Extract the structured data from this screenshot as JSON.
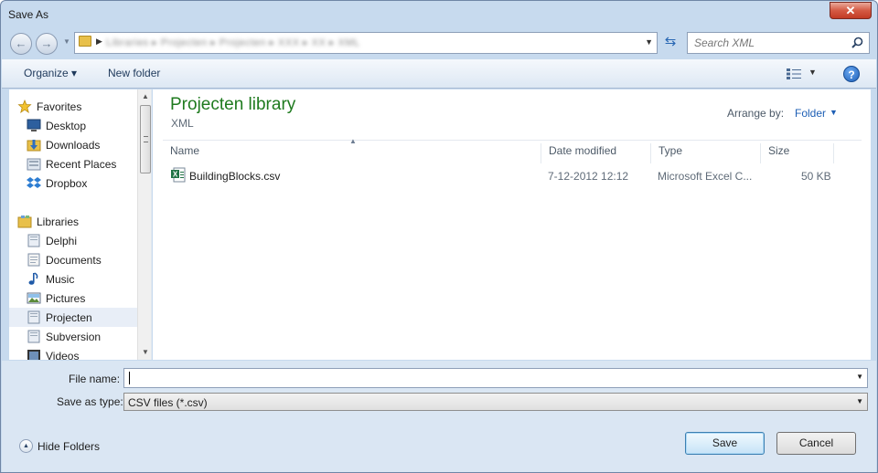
{
  "window": {
    "title": "Save As",
    "close_label": "✕"
  },
  "address_bar": {
    "path_text": "Libraries ▸ Projecten ▸ Projecten ▸ XXX ▸ XX ▸ XML",
    "search_placeholder": "Search XML"
  },
  "toolbar": {
    "organize_label": "Organize ▾",
    "new_folder_label": "New folder"
  },
  "nav": {
    "items": [
      {
        "label": "Favorites",
        "icon": "star-icon"
      },
      {
        "label": "Desktop",
        "icon": "desktop-icon"
      },
      {
        "label": "Downloads",
        "icon": "downloads-icon"
      },
      {
        "label": "Recent Places",
        "icon": "recent-places-icon"
      },
      {
        "label": "Dropbox",
        "icon": "dropbox-icon"
      },
      {
        "label": "Libraries",
        "icon": "libraries-icon"
      },
      {
        "label": "Delphi",
        "icon": "library-icon"
      },
      {
        "label": "Documents",
        "icon": "documents-icon"
      },
      {
        "label": "Music",
        "icon": "music-icon"
      },
      {
        "label": "Pictures",
        "icon": "pictures-icon"
      },
      {
        "label": "Projecten",
        "icon": "library-icon",
        "selected": true
      },
      {
        "label": "Subversion",
        "icon": "library-icon"
      },
      {
        "label": "Videos",
        "icon": "videos-icon"
      }
    ]
  },
  "content": {
    "library_title": "Projecten library",
    "library_subtitle": "XML",
    "arrange_by_label": "Arrange by:",
    "arrange_by_value": "Folder",
    "columns": [
      "Name",
      "Date modified",
      "Type",
      "Size"
    ],
    "files": [
      {
        "name": "BuildingBlocks.csv",
        "date_modified": "7-12-2012 12:12",
        "type": "Microsoft Excel C...",
        "size": "50 KB"
      }
    ]
  },
  "form": {
    "file_name_label": "File name:",
    "file_name_value": "",
    "save_type_label": "Save as type:",
    "save_type_value": "CSV files (*.csv)"
  },
  "footer": {
    "hide_folders_label": "Hide Folders",
    "save_label": "Save",
    "cancel_label": "Cancel"
  },
  "colors": {
    "accent": "#1e7a1e",
    "link": "#1e5fb5",
    "frame": "#c7daee"
  }
}
